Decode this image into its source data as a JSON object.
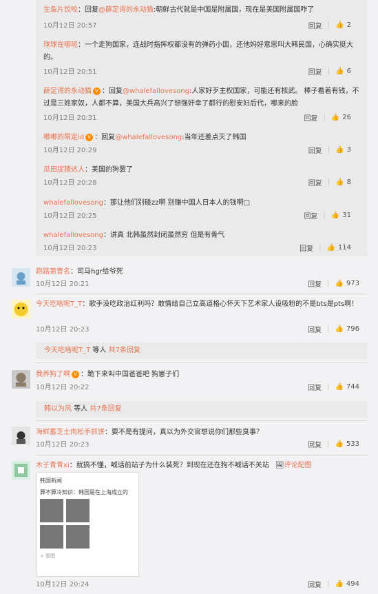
{
  "replies": [
    {
      "name": "生鱼片饺咬",
      "sep": "：",
      "prefix": "回复",
      "mention": "@薛定谔的永动猫",
      "text": ":朝鲜古代就是中国是附属国，现在是美国附属国咋了",
      "time": "10月12日 20:57",
      "reply": "回复",
      "likes": "2"
    },
    {
      "name": "球球在哪呢",
      "sep": "：",
      "prefix": "",
      "mention": "",
      "text": "一个走狗国家，连战时指挥权都没有的弹药小国，还他妈好意思叫大韩民国，心确实挺大的。",
      "time": "10月12日 20:51",
      "reply": "回复",
      "likes": "6"
    },
    {
      "name": "薛定谔的永动猫",
      "sep": "：",
      "prefix": "回复",
      "mention": "@whalefallovesong",
      "text": ":人家好歹主权国家，可能还有核武。 棒子看着有钱，不过是三姓家奴，人都不算，美国大兵高兴了想强奸幸了都行的慰安妇后代，哪来的脸",
      "time": "10月12日 20:31",
      "reply": "回复",
      "likes": "26"
    },
    {
      "name": "嘟嘟的限定id",
      "sep": "：",
      "prefix": "回复",
      "mention": "@whalefallovesong",
      "text": ":当年还差点灭了韩国",
      "time": "10月12日 20:29",
      "reply": "回复",
      "likes": "3"
    },
    {
      "name": "瓜田捉猹达人",
      "sep": "：",
      "prefix": "",
      "mention": "",
      "text": "美国的狗罢了",
      "time": "10月12日 20:28",
      "reply": "回复",
      "likes": "8"
    },
    {
      "name": "whalefallovesong",
      "sep": "：",
      "prefix": "",
      "mention": "",
      "text": "那让他们别碰zz啊 别赚中国人日本人的钱啊□",
      "time": "10月12日 20:25",
      "reply": "回复",
      "likes": "31"
    },
    {
      "name": "whalefallovesong",
      "sep": "：",
      "prefix": "",
      "mention": "",
      "text": "讲真 北韩虽然封闭虽然穷 但是有骨气",
      "time": "10月12日 20:23",
      "reply": "回复",
      "likes": "114"
    }
  ],
  "comments": [
    {
      "name": "跑路第壹名",
      "sep": "：",
      "text": "司马hgr给爷死",
      "time": "10月12日 20:21",
      "reply": "回复",
      "likes": "973"
    },
    {
      "name": "今天吃啥呢T_T",
      "sep": "：",
      "text": "歌手没吃政治红利吗？敢情给自己立高道格心怀天下艺术家人设吸粉的不是bts是pts啊！",
      "time": "10月12日 20:23",
      "reply": "回复",
      "likes": "796",
      "summary_name": "今天吃啥呢T_T",
      "summary_mid": "等人",
      "summary_count": "共7条回复"
    },
    {
      "name": "我养狗了啊",
      "sep": "：",
      "text": "跪下来叫中国爸爸吧 狗崽子们",
      "time": "10月12日 20:22",
      "reply": "回复",
      "likes": "744",
      "summary_name": "韩以为风",
      "summary_mid": "等人",
      "summary_count": "共7条回复"
    },
    {
      "name": "海鲜蓄芝士肉松手抓饼",
      "sep": "：",
      "text": "要不是有提问，真以为外交官想说你们那些臭事？",
      "time": "10月12日 20:23",
      "reply": "回复",
      "likes": "533"
    },
    {
      "name": "木子青青xi",
      "sep": "：",
      "text": "就搞不懂，喊话前站子为什么装死？到现在还在狗不喊话不关站",
      "time": "10月12日 20:24",
      "reply": "回复",
      "likes": "494",
      "pic_link": "评论配图"
    }
  ],
  "thumbnail": {
    "author": "韩国新闻",
    "title": "算不算冷知识：韩国是在上海成立的",
    "sub": "+ 原图"
  },
  "colors": {
    "accent": "#eb7350",
    "bg": "#f2f2f5",
    "reply_bg": "#eaeaea"
  }
}
